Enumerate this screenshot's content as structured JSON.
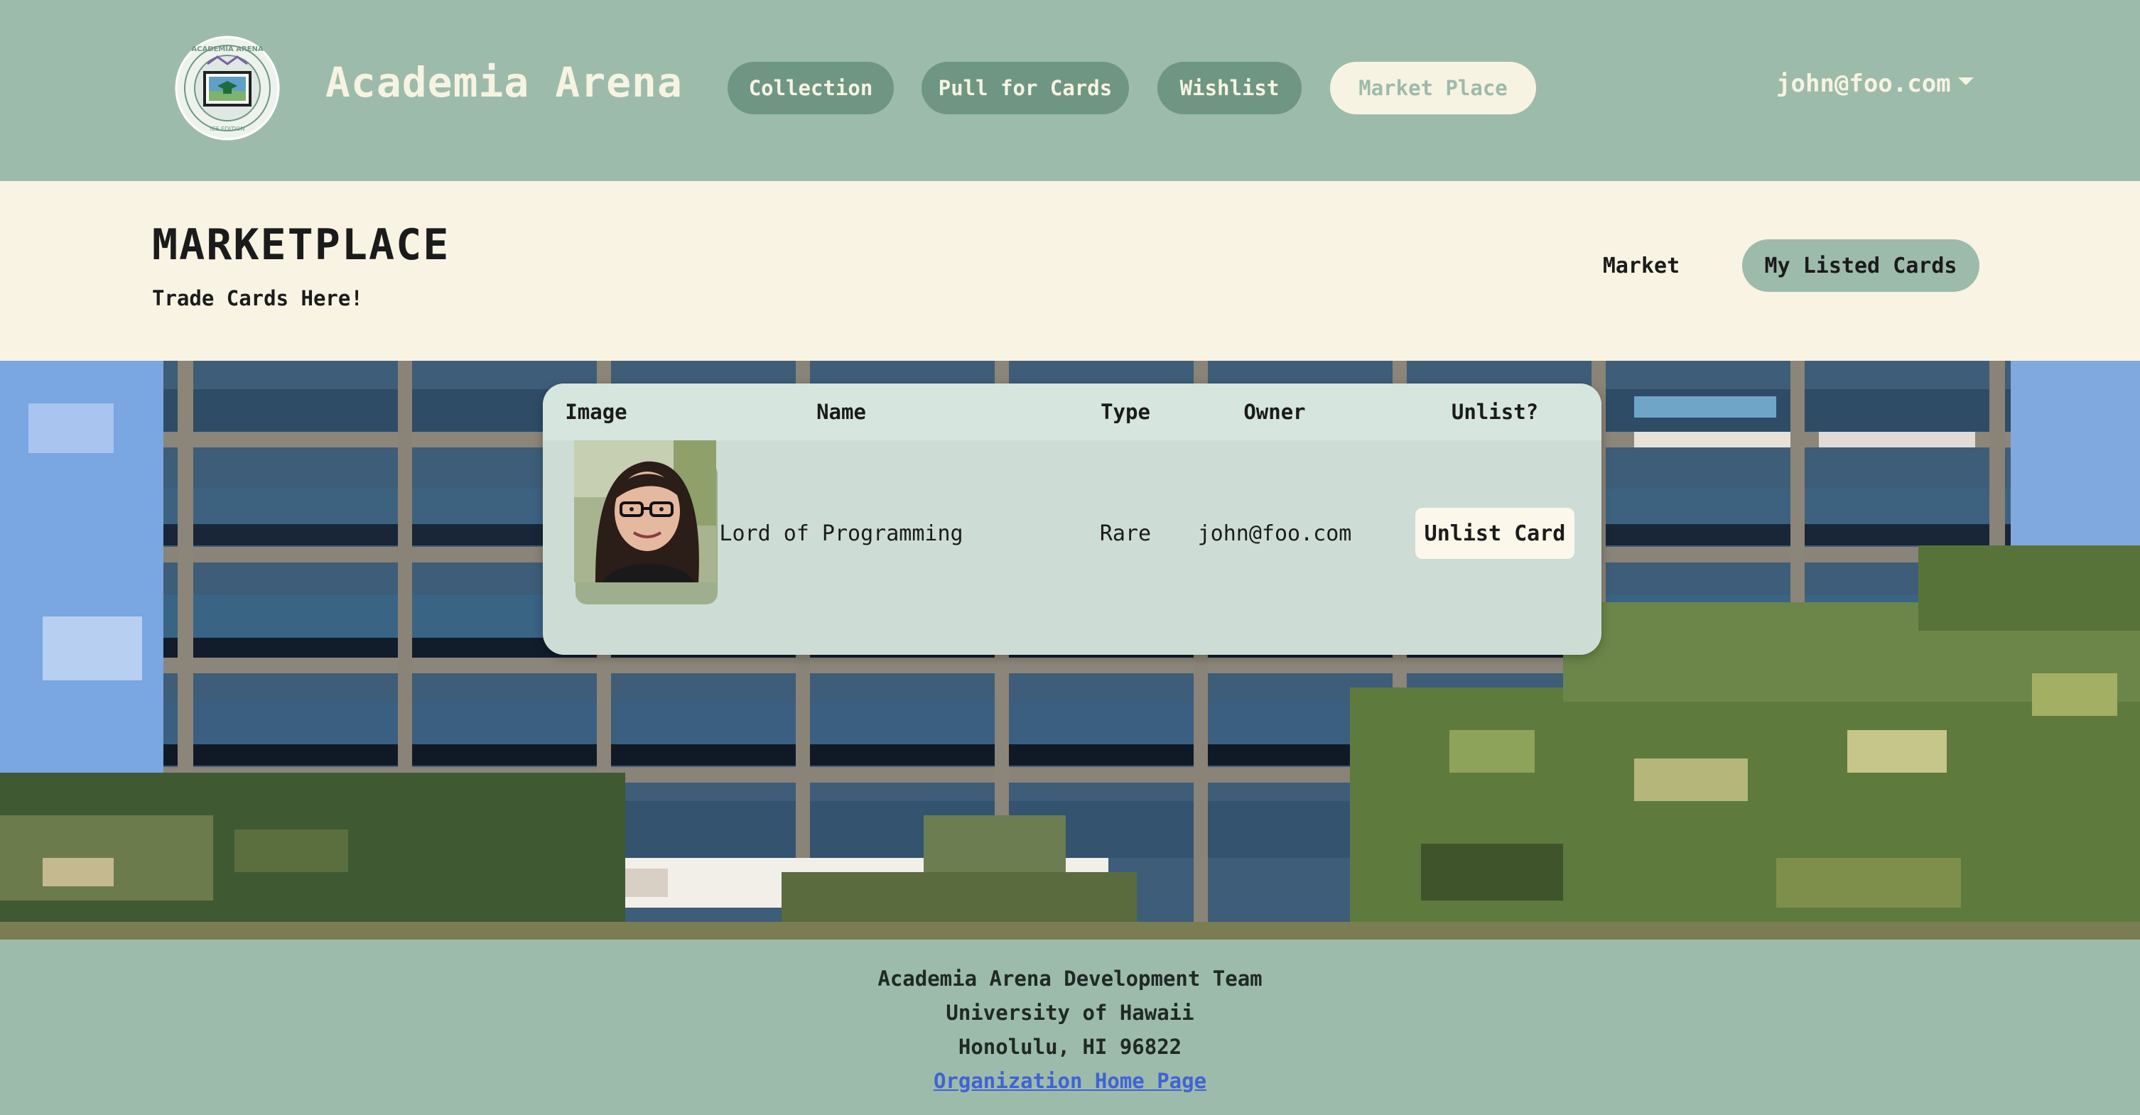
{
  "navbar": {
    "brand": "Academia Arena",
    "logo_text_top": "ACADEMIA ARENA",
    "logo_text_bottom": "ICS EDITION",
    "items": [
      {
        "label": "Collection",
        "active": false
      },
      {
        "label": "Pull for Cards",
        "active": false
      },
      {
        "label": "Wishlist",
        "active": false
      },
      {
        "label": "Market Place",
        "active": true
      }
    ],
    "user": "john@foo.com"
  },
  "header": {
    "title": "MARKETPLACE",
    "subtitle": "Trade Cards Here!",
    "links": [
      {
        "label": "Market",
        "active": false
      },
      {
        "label": "My Listed Cards",
        "active": true
      }
    ]
  },
  "table": {
    "columns": [
      "Image",
      "Name",
      "Type",
      "Owner",
      "Unlist?"
    ],
    "rows": [
      {
        "name": "Lord of Programming",
        "type": "Rare",
        "owner": "john@foo.com",
        "action": "Unlist Card"
      }
    ]
  },
  "footer": {
    "line1": "Academia Arena Development Team",
    "line2": "University of Hawaii",
    "line3": "Honolulu, HI 96822",
    "link": "Organization Home Page"
  },
  "colors": {
    "nav_bg": "#9dbbaa",
    "pill_bg": "#6f9683",
    "cream": "#f8f3e3",
    "link_blue": "#3f63d6"
  },
  "icons": {
    "logo": "academia-arena-logo-icon",
    "caret": "caret-down-icon"
  }
}
